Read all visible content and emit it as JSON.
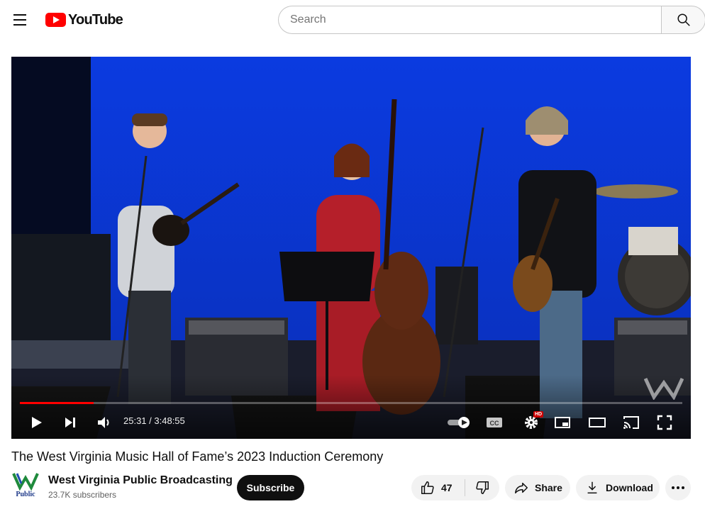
{
  "header": {
    "logo_text": "YouTube",
    "search_placeholder": "Search"
  },
  "player": {
    "time_current": "25:31",
    "time_separator": " / ",
    "time_total": "3:48:55",
    "progress_fraction": 0.111,
    "settings_badge": "HD",
    "colors": {
      "progress": "#ff0000",
      "stage_blue": "#0a36d8"
    },
    "icons": [
      "play-icon",
      "next-icon",
      "volume-icon",
      "autoplay-toggle-icon",
      "captions-icon",
      "settings-icon",
      "miniplayer-icon",
      "theater-mode-icon",
      "cast-icon",
      "fullscreen-icon"
    ]
  },
  "video": {
    "title": "The West Virginia Music Hall of Fame’s 2023 Induction Ceremony"
  },
  "channel": {
    "name": "West Virginia Public Broadcasting",
    "subscribers": "23.7K subscribers",
    "avatar_text": "Public",
    "subscribe_label": "Subscribe"
  },
  "actions": {
    "like_count": "47",
    "share_label": "Share",
    "download_label": "Download"
  }
}
